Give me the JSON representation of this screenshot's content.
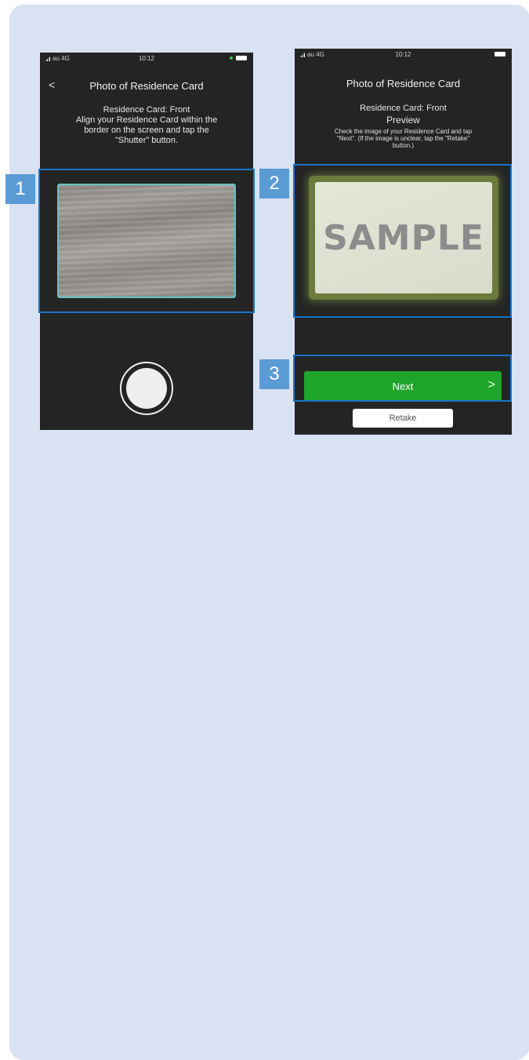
{
  "phone1": {
    "status": {
      "carrier": "au",
      "network": "4G",
      "time": "10:12"
    },
    "title": "Photo of Residence Card",
    "back_label": "<",
    "instructions": [
      "Residence Card: Front",
      "Align your Residence Card within the",
      "border on the screen and tap the",
      "\"Shutter\" button."
    ]
  },
  "phone2": {
    "status": {
      "carrier": "au",
      "network": "4G",
      "time": "10:12"
    },
    "title": "Photo of Residence Card",
    "subtitle": "Residence Card: Front",
    "preview_label": "Preview",
    "note": [
      "Check the image of your Residence Card and tap",
      "\"Next\". (If the image is unclear, tap the \"Retake\"",
      "button.)"
    ],
    "sample_text": "SAMPLE",
    "next_label": "Next",
    "next_chevron": ">",
    "retake_label": "Retake"
  },
  "callouts": [
    {
      "number": "1"
    },
    {
      "number": "2"
    },
    {
      "number": "3"
    }
  ],
  "colors": {
    "panel_bg": "#d9e2f3",
    "badge": "#5b9bd5",
    "highlight_border": "#1a73c9",
    "next_button": "#1ea52a",
    "guide_border": "#63c2c4"
  }
}
